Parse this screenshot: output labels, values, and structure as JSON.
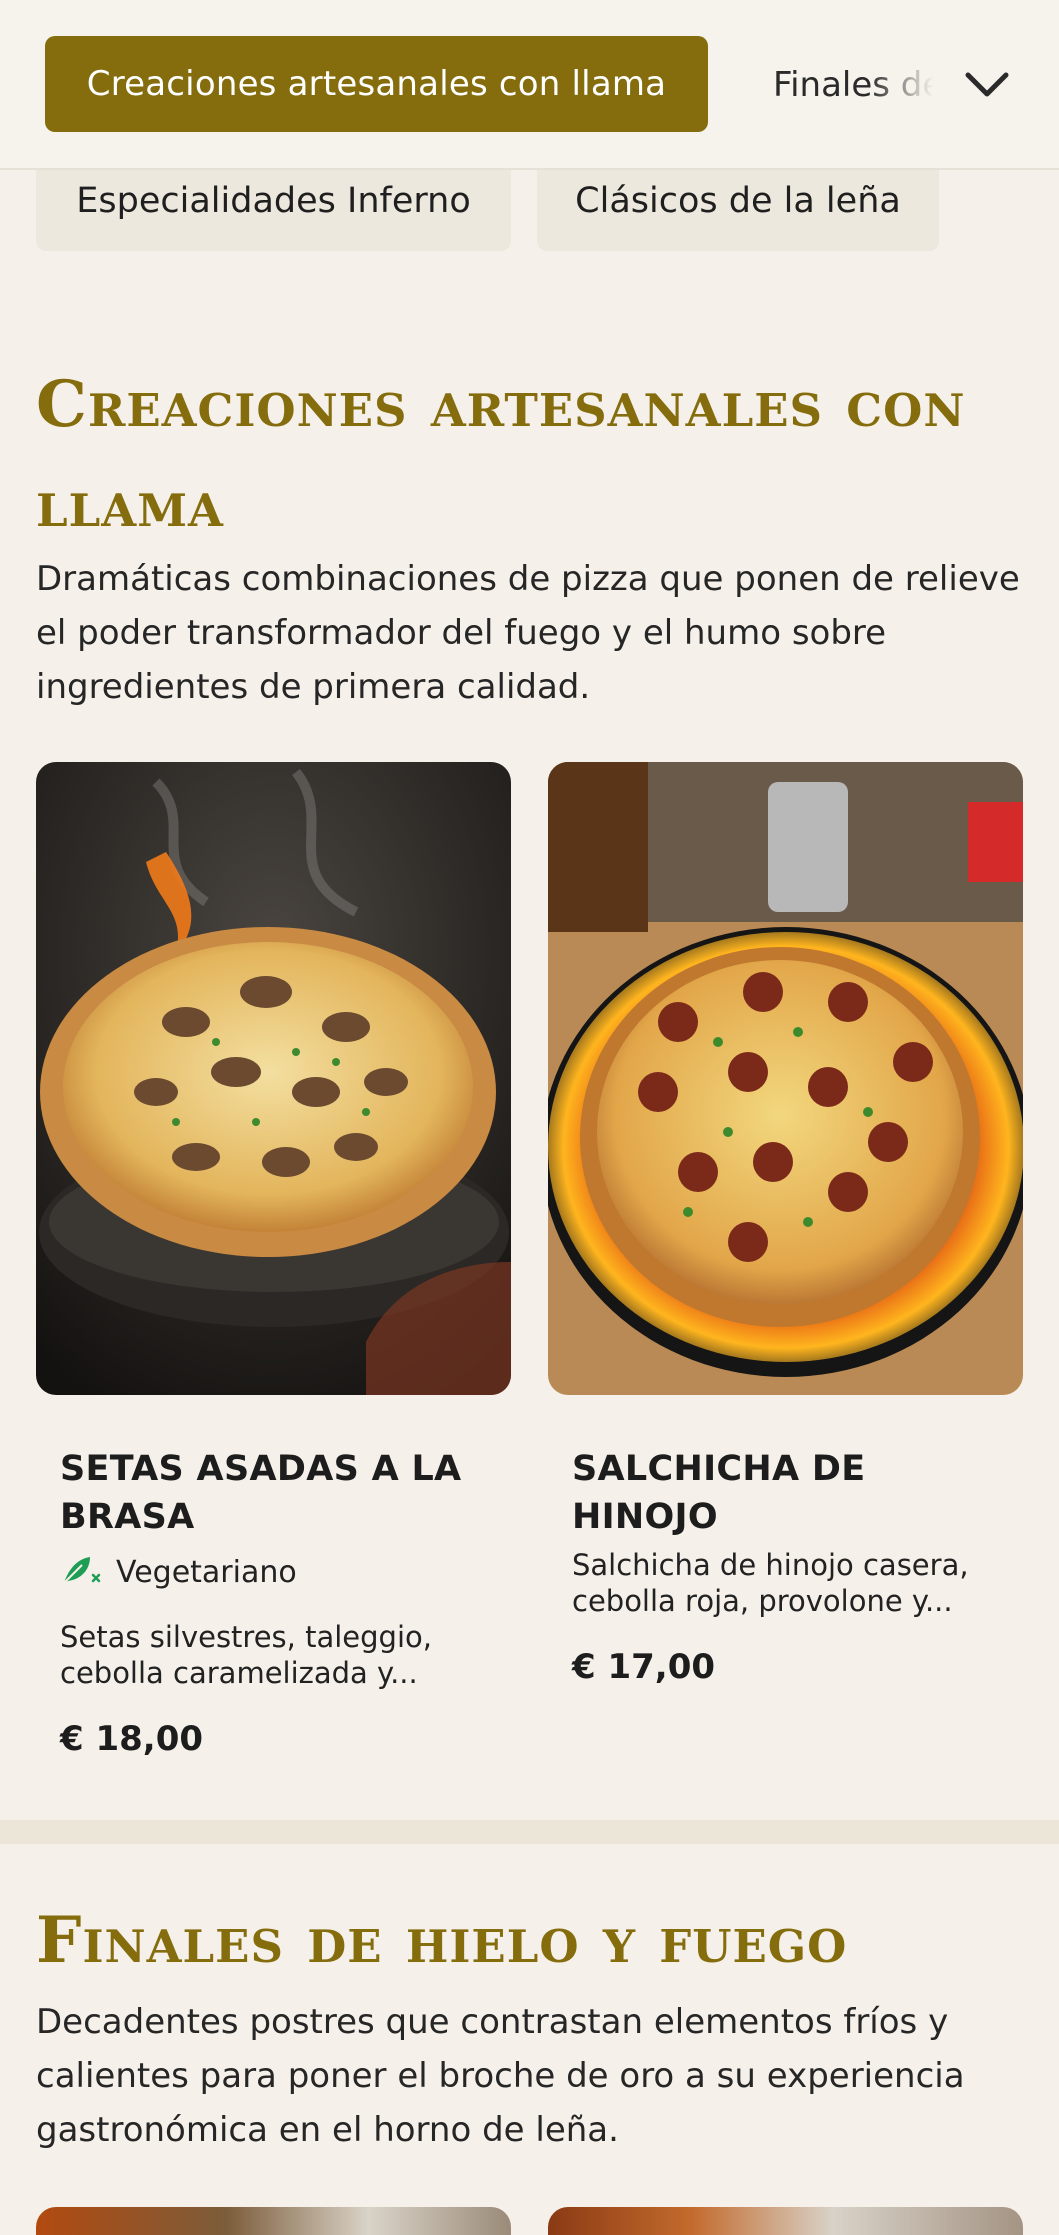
{
  "nav": {
    "active_tab": "Creaciones artesanales con llama",
    "next_tab": "Finales de hielo y fuego",
    "pills": [
      "Especialidades Inferno",
      "Clásicos de la leña"
    ]
  },
  "sections": [
    {
      "title": "Creaciones artesanales con llama",
      "description": "Dramáticas combinaciones de pizza que ponen de relieve el poder transformador del fuego y el humo sobre ingredientes de primera calidad.",
      "items": [
        {
          "name": "SETAS ASADAS A LA BRASA",
          "badge": "Vegetariano",
          "description": "Setas silvestres, taleggio, cebolla caramelizada y...",
          "price": "€ 18,00"
        },
        {
          "name": "SALCHICHA DE HINOJO",
          "description": "Salchicha de hinojo casera, cebolla roja, provolone y...",
          "price": "€ 17,00"
        }
      ]
    },
    {
      "title": "Finales de hielo y fuego",
      "description": "Decadentes postres que contrastan elementos fríos y calientes para poner el broche de oro a su experiencia gastronómica en el horno de leña."
    }
  ],
  "colors": {
    "accent": "#856d0e",
    "background": "#f5f1ea",
    "veg_icon": "#1f9d55"
  },
  "icons": {
    "dropdown": "chevron-down-icon",
    "vegetarian": "leaf-icon"
  }
}
